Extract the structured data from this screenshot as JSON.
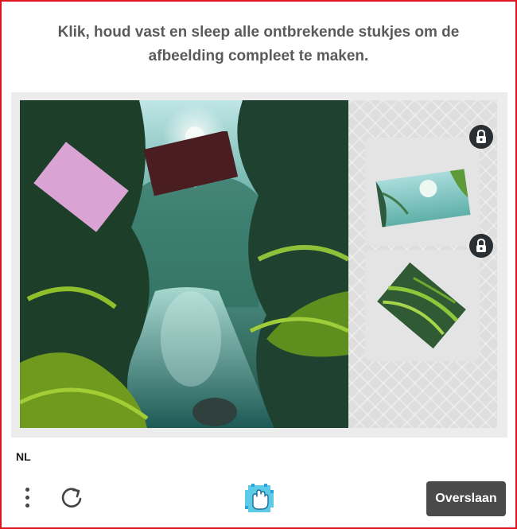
{
  "instruction": "Klik, houd vast en sleep alle ontbrekende stukjes om de afbeelding compleet te maken.",
  "language": "NL",
  "buttons": {
    "skip_label": "Overslaan"
  },
  "icons": {
    "menu": "more-vertical-icon",
    "refresh": "refresh-icon",
    "lock": "lock-icon",
    "logo": "hand-logo-icon"
  },
  "colors": {
    "frame_border": "#e0141e",
    "instruction_text": "#5a5a5a",
    "skip_button_bg": "#4a4a4a",
    "piece_pink": "#d9a3d4",
    "piece_maroon": "#4a1d20",
    "lock_bg": "#2a2f33"
  }
}
